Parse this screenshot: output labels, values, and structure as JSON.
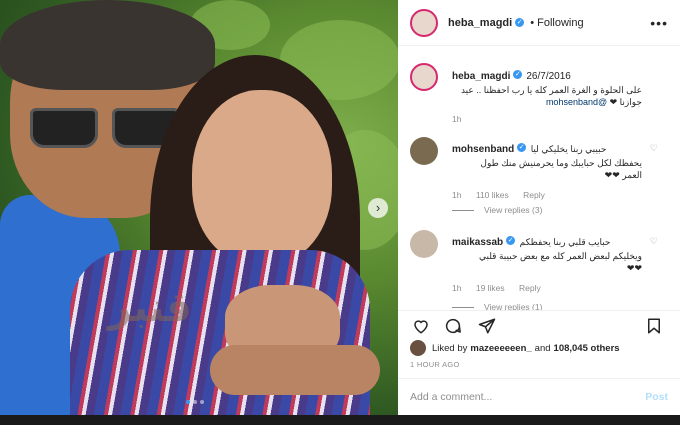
{
  "post": {
    "username": "heba_magdi",
    "follow_label": "Following",
    "more": "•••",
    "carousel_dots": 3,
    "watermark": "قنبر"
  },
  "caption": {
    "username": "heba_magdi",
    "date": "26/7/2016",
    "line1": "على الحلوة و الغرة العمر كله يا رب احفظنا .. عيد",
    "line2_mention": "@mohsenband",
    "line2_text": "جوازنا ❤",
    "age": "1h"
  },
  "comments": [
    {
      "username": "mohsenband",
      "line1": "حبيبي ربنا يخليكي ليا",
      "line2": "يحفظك لكل حبايبك وما يحرمنيش منك طول",
      "line3": "العمر ❤❤",
      "age": "1h",
      "likes": "110 likes",
      "reply": "Reply",
      "view_replies": "View replies (3)"
    },
    {
      "username": "maikassab",
      "line1": "حبايب قلبي ربنا يحفظكم",
      "line2": "ويخليكم لبعض العمر كله مع بعض حبيبة قلبي",
      "line3": "❤❤",
      "age": "1h",
      "likes": "19 likes",
      "reply": "Reply",
      "view_replies": "View replies (1)"
    }
  ],
  "likes_row": {
    "prefix": "Liked by",
    "user": "mazeeeeeen_",
    "and": "and",
    "count": "108,045 others"
  },
  "time_ago": "1 HOUR AGO",
  "add_comment": {
    "placeholder": "Add a comment...",
    "post_label": "Post"
  }
}
